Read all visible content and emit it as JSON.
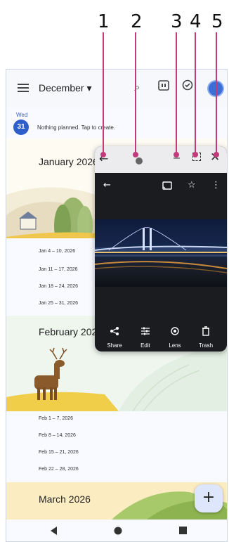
{
  "callouts": [
    "1",
    "2",
    "3",
    "4",
    "5"
  ],
  "calendar": {
    "month_selector": "December ▾",
    "today": {
      "day": "Wed",
      "date": "31",
      "text": "Nothing planned. Tap to create."
    },
    "months": [
      {
        "title": "January 2026",
        "weeks": [
          "Jan 4 – 10, 2026",
          "Jan 11 – 17, 2026",
          "Jan 18 – 24, 2026",
          "Jan 25 – 31, 2026"
        ]
      },
      {
        "title": "February 2026",
        "weeks": [
          "Feb 1 – 7, 2026",
          "Feb 8 – 14, 2026",
          "Feb 15 – 21, 2026",
          "Feb 22 – 28, 2026"
        ]
      },
      {
        "title": "March 2026",
        "weeks": []
      }
    ],
    "fab_label": "+"
  },
  "floating_window": {
    "photo_actions": [
      {
        "icon": "share-icon",
        "glyph": "<",
        "label": "Share"
      },
      {
        "icon": "edit-icon",
        "glyph": "⫶",
        "label": "Edit"
      },
      {
        "icon": "lens-icon",
        "glyph": "◎",
        "label": "Lens"
      },
      {
        "icon": "trash-icon",
        "glyph": "▮",
        "label": "Trash"
      }
    ]
  },
  "colors": {
    "callout": "#c23a7a",
    "accent": "#2d5ec9",
    "window_bg": "#1b1c20"
  }
}
